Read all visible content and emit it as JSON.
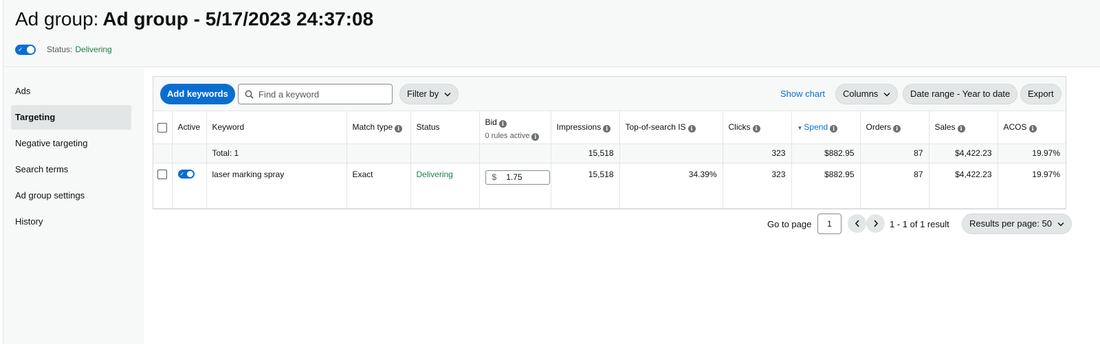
{
  "header": {
    "title_prefix": "Ad group:",
    "title_name": "Ad group - 5/17/2023 24:37:08",
    "status_label": "Status:",
    "status_value": "Delivering"
  },
  "sidebar": {
    "items": [
      {
        "label": "Ads",
        "active": false
      },
      {
        "label": "Targeting",
        "active": true
      },
      {
        "label": "Negative targeting",
        "active": false
      },
      {
        "label": "Search terms",
        "active": false
      },
      {
        "label": "Ad group settings",
        "active": false
      },
      {
        "label": "History",
        "active": false
      }
    ]
  },
  "toolbar": {
    "add_keywords": "Add keywords",
    "search_placeholder": "Find a keyword",
    "filter_by": "Filter by",
    "show_chart": "Show chart",
    "columns": "Columns",
    "date_range": "Date range - Year to date",
    "export": "Export"
  },
  "table": {
    "headers": {
      "active": "Active",
      "keyword": "Keyword",
      "match_type": "Match type",
      "status": "Status",
      "bid": "Bid",
      "bid_sub": "0 rules active",
      "impressions": "Impressions",
      "top_of_search": "Top-of-search IS",
      "clicks": "Clicks",
      "spend": "Spend",
      "orders": "Orders",
      "sales": "Sales",
      "acos": "ACOS"
    },
    "total": {
      "label": "Total: 1",
      "impressions": "15,518",
      "clicks": "323",
      "spend": "$882.95",
      "orders": "87",
      "sales": "$4,422.23",
      "acos": "19.97%"
    },
    "rows": [
      {
        "keyword": "laser marking spray",
        "match_type": "Exact",
        "status": "Delivering",
        "bid_currency": "$",
        "bid": "1.75",
        "impressions": "15,518",
        "top_of_search": "34.39%",
        "clicks": "323",
        "spend": "$882.95",
        "orders": "87",
        "sales": "$4,422.23",
        "acos": "19.97%"
      }
    ]
  },
  "pagination": {
    "goto_label": "Go to page",
    "page": "1",
    "range": "1 - 1 of 1 result",
    "results_per_page": "Results per page: 50"
  },
  "colors": {
    "accent": "#0a6ed1",
    "status_green": "#1a7f47"
  }
}
